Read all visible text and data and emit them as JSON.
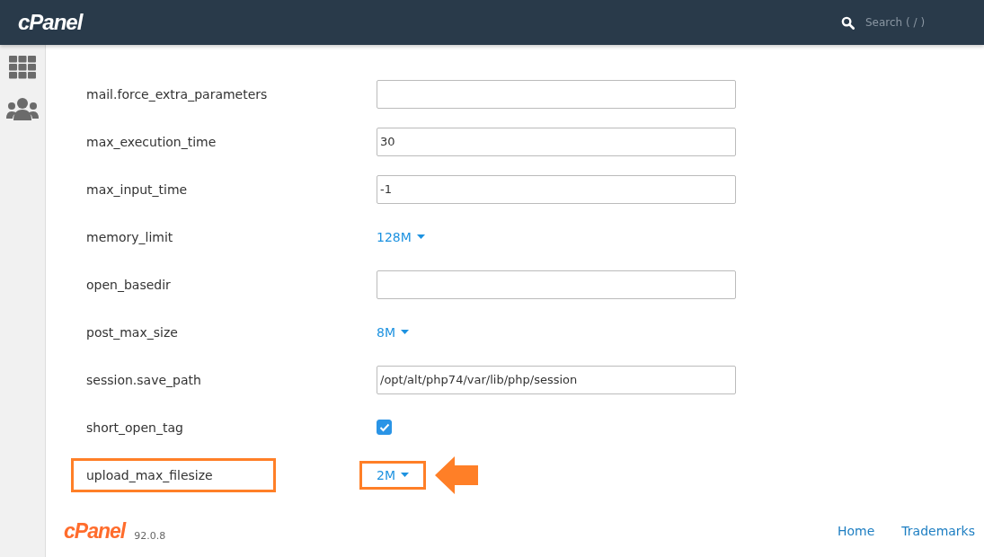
{
  "header": {
    "logo": "cPanel",
    "search": {
      "placeholder": "Search ( / )"
    }
  },
  "settings": [
    {
      "name": "mail.force_extra_parameters",
      "kind": "text",
      "highlighted": false
    },
    {
      "name": "max_execution_time",
      "kind": "text",
      "value": "30",
      "highlighted": false
    },
    {
      "name": "max_input_time",
      "kind": "text",
      "value": "-1",
      "highlighted": false
    },
    {
      "name": "memory_limit",
      "kind": "select",
      "value": "128M",
      "highlighted": false
    },
    {
      "name": "open_basedir",
      "kind": "text",
      "highlighted": false
    },
    {
      "name": "post_max_size",
      "kind": "select",
      "value": "8M",
      "highlighted": false
    },
    {
      "name": "session.save_path",
      "kind": "text",
      "value": "/opt/alt/php74/var/lib/php/session",
      "highlighted": false
    },
    {
      "name": "short_open_tag",
      "kind": "checkbox",
      "checked": true,
      "highlighted": false
    },
    {
      "name": "upload_max_filesize",
      "kind": "select",
      "value": "2M",
      "highlighted": true
    }
  ],
  "footer": {
    "logo": "cPanel",
    "version": "92.0.8",
    "links": [
      "Home",
      "Trademarks"
    ]
  }
}
